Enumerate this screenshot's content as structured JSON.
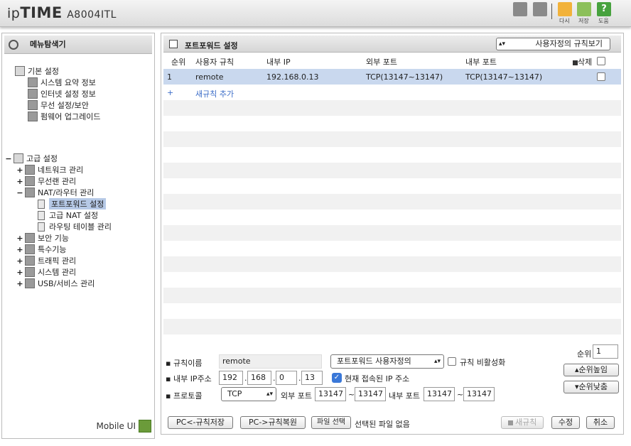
{
  "app": {
    "logo_ip": "ip",
    "logo_time": "TIME",
    "model": "A8004ITL"
  },
  "toolbar": {
    "refresh_label": "다시",
    "save_label": "저장",
    "help_label": "도움",
    "help_glyph": "?"
  },
  "sidebar": {
    "title": "메뉴탐색기",
    "basic": {
      "label": "기본 설정",
      "items": [
        "시스템 요약 정보",
        "인터넷 설정 정보",
        "무선 설정/보안",
        "펌웨어 업그레이드"
      ]
    },
    "advanced": {
      "label": "고급 설정",
      "items": [
        {
          "plus": "+",
          "label": "네트워크 관리"
        },
        {
          "plus": "+",
          "label": "무선랜 관리"
        },
        {
          "plus": "−",
          "label": "NAT/라우터 관리"
        }
      ],
      "nat_children": [
        "포트포워드 설정",
        "고급 NAT 설정",
        "라우팅 테이블 관리"
      ],
      "more": [
        {
          "plus": "+",
          "label": "보안 기능"
        },
        {
          "plus": "+",
          "label": "특수기능"
        },
        {
          "plus": "+",
          "label": "트래픽 관리"
        },
        {
          "plus": "+",
          "label": "시스템 관리"
        },
        {
          "plus": "+",
          "label": "USB/서비스 관리"
        }
      ]
    },
    "adv_minus": "−",
    "mobile_ui": "Mobile UI"
  },
  "main": {
    "title": "포트포워드 설정",
    "view_select": "사용자정의 규칙보기",
    "columns": {
      "order": "순위",
      "name": "사용자 규칙",
      "internal_ip": "내부 IP",
      "external_port": "외부 포트",
      "internal_port": "내부 포트",
      "delete": "삭제"
    },
    "rules": [
      {
        "order": "1",
        "name": "remote",
        "internal_ip": "192.168.0.13",
        "external_port": "TCP(13147~13147)",
        "internal_port": "TCP(13147~13147)"
      }
    ],
    "add_plus": "+",
    "add_rule": "새규칙 추가"
  },
  "form": {
    "rule_name_label": "규칙이름",
    "rule_name": "remote",
    "type_select": "포트포워드 사용자정의",
    "disable_label": "규칙 비활성화",
    "order_label": "순위",
    "order_value": "1",
    "ip_label": "내부 IP주소",
    "ip": [
      "192",
      "168",
      "0",
      "13"
    ],
    "current_ip_label": "현재 접속된 IP 주소",
    "protocol_label": "프로토콜",
    "protocol": "TCP",
    "ext_port_label": "외부 포트",
    "ext_port_from": "13147",
    "ext_port_to": "13147",
    "int_port_label": "내부 포트",
    "int_port_from": "13147",
    "int_port_to": "13147",
    "tilde": "~",
    "dot": ".",
    "order_up": "순위높임",
    "order_down": "순위낮춤"
  },
  "footer": {
    "pc_save": "PC<-규칙저장",
    "pc_restore": "PC->규칙복원",
    "file_choose": "파일 선택",
    "no_file": "선택된 파일 없음",
    "new_rule": "새규칙",
    "modify": "수정",
    "cancel": "취소"
  }
}
